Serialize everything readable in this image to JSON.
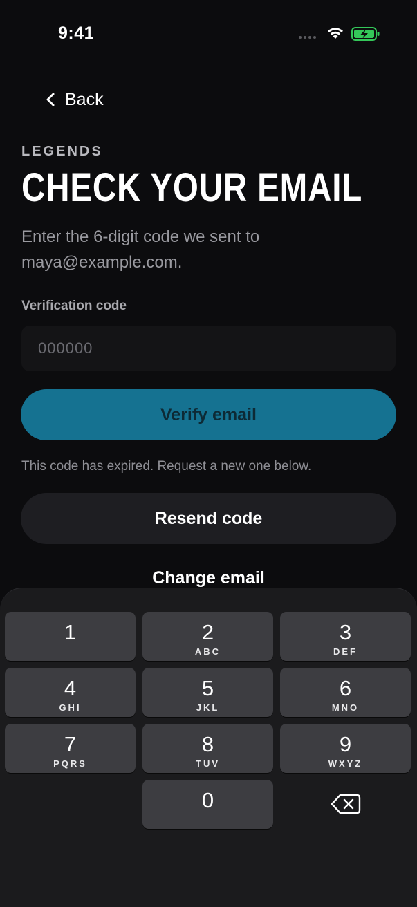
{
  "status_bar": {
    "time": "9:41"
  },
  "nav": {
    "back_label": "Back"
  },
  "header": {
    "brand": "LEGENDS",
    "title": "CHECK YOUR EMAIL",
    "subtitle": "Enter the 6-digit code we sent to maya@example.com."
  },
  "form": {
    "code_label": "Verification code",
    "code_placeholder": "000000",
    "code_value": "",
    "verify_label": "Verify email",
    "expired_message": "This code has expired. Request a new one below.",
    "resend_label": "Resend code",
    "change_email_label": "Change email"
  },
  "keypad": {
    "keys": [
      {
        "digit": "1",
        "letters": ""
      },
      {
        "digit": "2",
        "letters": "ABC"
      },
      {
        "digit": "3",
        "letters": "DEF"
      },
      {
        "digit": "4",
        "letters": "GHI"
      },
      {
        "digit": "5",
        "letters": "JKL"
      },
      {
        "digit": "6",
        "letters": "MNO"
      },
      {
        "digit": "7",
        "letters": "PQRS"
      },
      {
        "digit": "8",
        "letters": "TUV"
      },
      {
        "digit": "9",
        "letters": "WXYZ"
      },
      {
        "digit": "0",
        "letters": ""
      }
    ],
    "delete_icon": "backspace-icon"
  },
  "colors": {
    "background": "#0c0c0e",
    "accent": "#157291",
    "secondary_button": "#1e1e22",
    "battery": "#34c759"
  }
}
